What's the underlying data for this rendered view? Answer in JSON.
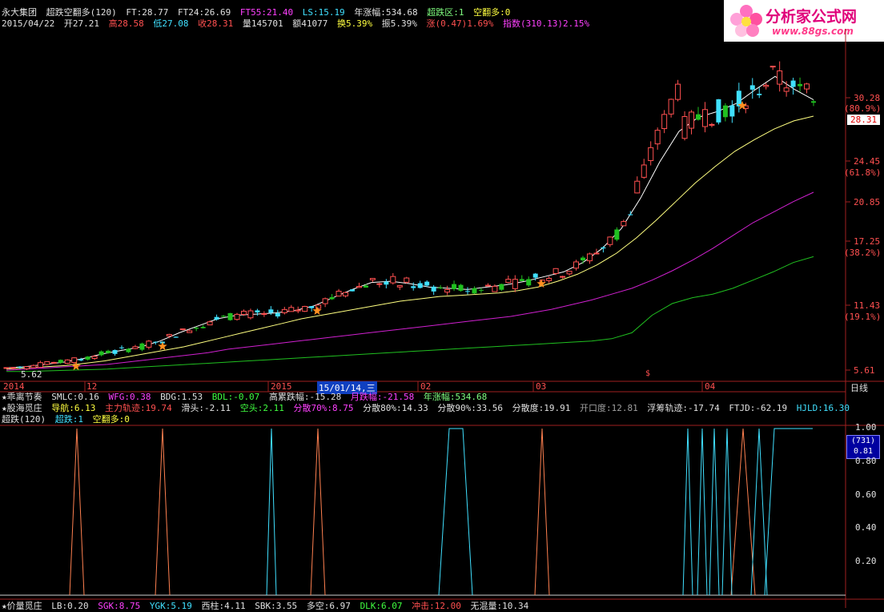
{
  "header": {
    "stock_name": "永大集团",
    "indicator": "超跌空翻多(120)",
    "ft": "FT:28.77",
    "ft24": "FT24:26.69",
    "ft55": "FT55:21.40",
    "ls": "LS:15.19",
    "year_gain": "年涨幅:534.68",
    "oversold_zone": "超跌区:1",
    "short_to_long": "空翻多:0"
  },
  "quote": {
    "date": "2015/04/22",
    "open": "开27.21",
    "high": "高28.58",
    "low": "低27.08",
    "close": "收28.31",
    "volume": "量145701",
    "amount": "额41077",
    "turnover": "换5.39%",
    "amplitude": "振5.39%",
    "change": "涨(0.47)1.69%",
    "index": "指数(310.13)2.15%"
  },
  "logo": {
    "title": "分析家公式网",
    "url": "www.88gs.com"
  },
  "price_axis": {
    "labels": [
      "30.28",
      "(80.9%)",
      "24.45",
      "(61.8%)",
      "20.85",
      "17.25",
      "(38.2%)",
      "11.43",
      "(19.1%)",
      "5.61"
    ],
    "current_price": "28.31",
    "low_label": "5.62"
  },
  "date_axis": {
    "labels": [
      "2014",
      "12",
      "2015",
      "02",
      "03",
      "04"
    ],
    "cursor_date": "15/01/14,三",
    "period": "日线"
  },
  "info_row1": {
    "name": "★乖离节奏",
    "smlc": "SMLC:0.16",
    "wfg": "WFG:0.38",
    "bdg": "BDG:1.53",
    "bdl": "BDL:-0.07",
    "high_drop": "高累跌幅:-15.28",
    "month_drop": "月跌幅:-21.58",
    "year_gain": "年涨幅:534.68"
  },
  "info_row2": {
    "name": "★股海觅庄",
    "nav": "导航:6.13",
    "main_track": "主力轨迹:19.74",
    "slide": "滑头:-2.11",
    "short": "空头:2.11",
    "disp70": "分散70%:8.75",
    "disp80": "分散80%:14.33",
    "disp90": "分散90%:33.56",
    "disp_deg": "分散度:19.91",
    "open_deg": "开口度:12.81",
    "float_track": "浮筹轨迹:-17.74",
    "ftjd": "FTJD:-62.19",
    "hjld": "HJLD:16.30"
  },
  "sub_header": {
    "name": "超跌(120)",
    "oversold": "超跌:1",
    "short_to_long": "空翻多:0"
  },
  "sub_axis": {
    "labels": [
      "1.00",
      "0.80",
      "0.60",
      "0.40",
      "0.20"
    ],
    "box_top": "(731)",
    "box_bottom": "0.81"
  },
  "bottom_row": {
    "name": "★价量觅庄",
    "lb": "LB:0.20",
    "sgk": "SGK:8.75",
    "ygk": "YGK:5.19",
    "xizhu": "西柱:4.11",
    "sbk": "SBK:3.55",
    "duokong": "多空:6.97",
    "dlk": "DLK:6.07",
    "chongji": "冲击:12.00",
    "wuliang": "无混量:10.34"
  },
  "chart_data": {
    "type": "candlestick",
    "price_range": [
      5.61,
      34.0
    ],
    "ma_white": [
      6.0,
      6.1,
      6.3,
      6.5,
      6.8,
      7.2,
      7.5,
      7.8,
      8.3,
      9.0,
      9.6,
      10.2,
      10.5,
      10.6,
      10.7,
      10.9,
      11.3,
      12.0,
      12.7,
      13.3,
      13.4,
      13.2,
      12.9,
      12.8,
      12.7,
      12.9,
      13.1,
      13.4,
      13.8,
      14.2,
      15.0,
      16.2,
      17.9,
      20.5,
      23.6,
      26.2,
      27.4,
      27.9,
      28.6,
      29.8,
      30.9,
      29.8,
      28.9
    ],
    "ma_yellow": [
      5.9,
      6.0,
      6.1,
      6.2,
      6.4,
      6.6,
      6.9,
      7.2,
      7.5,
      7.8,
      8.2,
      8.6,
      9.0,
      9.4,
      9.8,
      10.2,
      10.5,
      10.8,
      11.1,
      11.4,
      11.7,
      11.9,
      12.1,
      12.2,
      12.3,
      12.4,
      12.6,
      12.9,
      13.4,
      14.0,
      14.8,
      15.8,
      17.1,
      18.6,
      20.2,
      21.8,
      23.2,
      24.5,
      25.5,
      26.4,
      27.1,
      27.5
    ],
    "ma_magenta": [
      5.8,
      5.9,
      6.0,
      6.1,
      6.2,
      6.3,
      6.5,
      6.7,
      6.9,
      7.1,
      7.3,
      7.6,
      7.8,
      8.0,
      8.2,
      8.4,
      8.6,
      8.8,
      9.0,
      9.2,
      9.4,
      9.6,
      9.8,
      10.0,
      10.2,
      10.4,
      10.7,
      11.0,
      11.4,
      11.8,
      12.3,
      12.8,
      13.5,
      14.3,
      15.2,
      16.2,
      17.3,
      18.4,
      19.3,
      20.2,
      21.0
    ],
    "ma_green": [
      5.7,
      5.7,
      5.75,
      5.8,
      5.85,
      5.9,
      6.0,
      6.1,
      6.2,
      6.3,
      6.4,
      6.5,
      6.6,
      6.7,
      6.8,
      6.9,
      7.0,
      7.1,
      7.2,
      7.3,
      7.4,
      7.5,
      7.6,
      7.7,
      7.8,
      7.9,
      8.0,
      8.1,
      8.2,
      8.3,
      8.5,
      9.0,
      10.5,
      11.5,
      12.0,
      12.3,
      12.8,
      13.5,
      14.2,
      15.0,
      15.5
    ],
    "sub_signal_range": [
      0,
      1.0
    ],
    "current_price": 28.31
  }
}
